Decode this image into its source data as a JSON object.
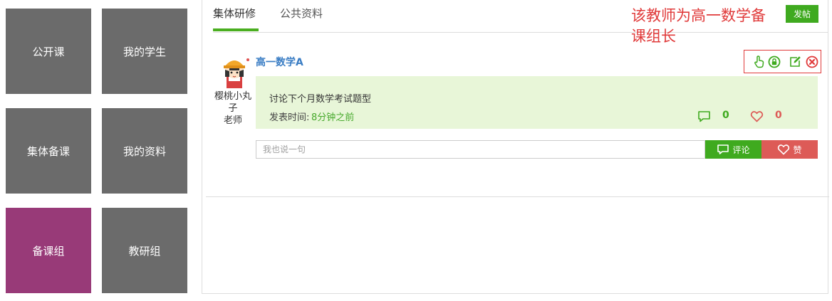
{
  "nav": {
    "tiles": [
      {
        "label": "公开课"
      },
      {
        "label": "我的学生"
      },
      {
        "label": "集体备课"
      },
      {
        "label": "我的资料"
      },
      {
        "label": "备课组",
        "active": true
      },
      {
        "label": "教研组"
      }
    ]
  },
  "tabs": [
    {
      "label": "集体研修",
      "active": true
    },
    {
      "label": "公共资料"
    }
  ],
  "post_button_label": "发帖",
  "annotation": "该教师为高一数学备课组长",
  "post": {
    "title": "高一数学A",
    "author_name": "樱桃小丸子",
    "author_role": "老师",
    "content": "讨论下个月数学考试题型",
    "time_label": "发表时间:",
    "time_value": "8分钟之前",
    "comment_count": "0",
    "like_count": "0",
    "actions": [
      "hand-pointer-icon",
      "lock-icon",
      "edit-icon",
      "delete-icon"
    ]
  },
  "comment_box": {
    "placeholder": "我也说一句",
    "comment_button_label": "评论",
    "like_button_label": "赞"
  },
  "colors": {
    "tile": "#6b6b6b",
    "tile_active": "#983a78",
    "green": "#3faa1f",
    "red": "#dd5b57",
    "annotation": "#e03a3a",
    "post_bg": "#e8f6d8",
    "link": "#3a7dc4"
  }
}
